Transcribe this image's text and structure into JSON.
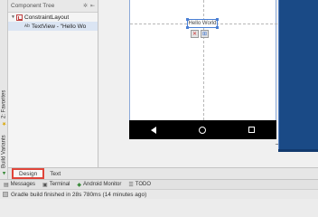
{
  "left_tools": {
    "favorites": "2: Favorites",
    "build_variants": "Build Variants"
  },
  "component_tree": {
    "title": "Component Tree",
    "items": [
      {
        "label": "ConstraintLayout"
      },
      {
        "label": "TextView - \"Hello Wo"
      }
    ]
  },
  "canvas": {
    "widget_text": "Hello World",
    "accent": "#4a7fd4",
    "blueprint_color": "#1a4a86"
  },
  "editor_tabs": [
    {
      "label": "Design",
      "active": true
    },
    {
      "label": "Text",
      "active": false
    }
  ],
  "tool_windows": [
    {
      "label": "Messages",
      "icon": "messages-icon"
    },
    {
      "label": "Terminal",
      "icon": "terminal-icon"
    },
    {
      "label": "Android Monitor",
      "icon": "android-icon"
    },
    {
      "label": "TODO",
      "icon": "todo-icon"
    }
  ],
  "status": {
    "text": "Gradle build finished in 28s 780ms (14 minutes ago)"
  }
}
